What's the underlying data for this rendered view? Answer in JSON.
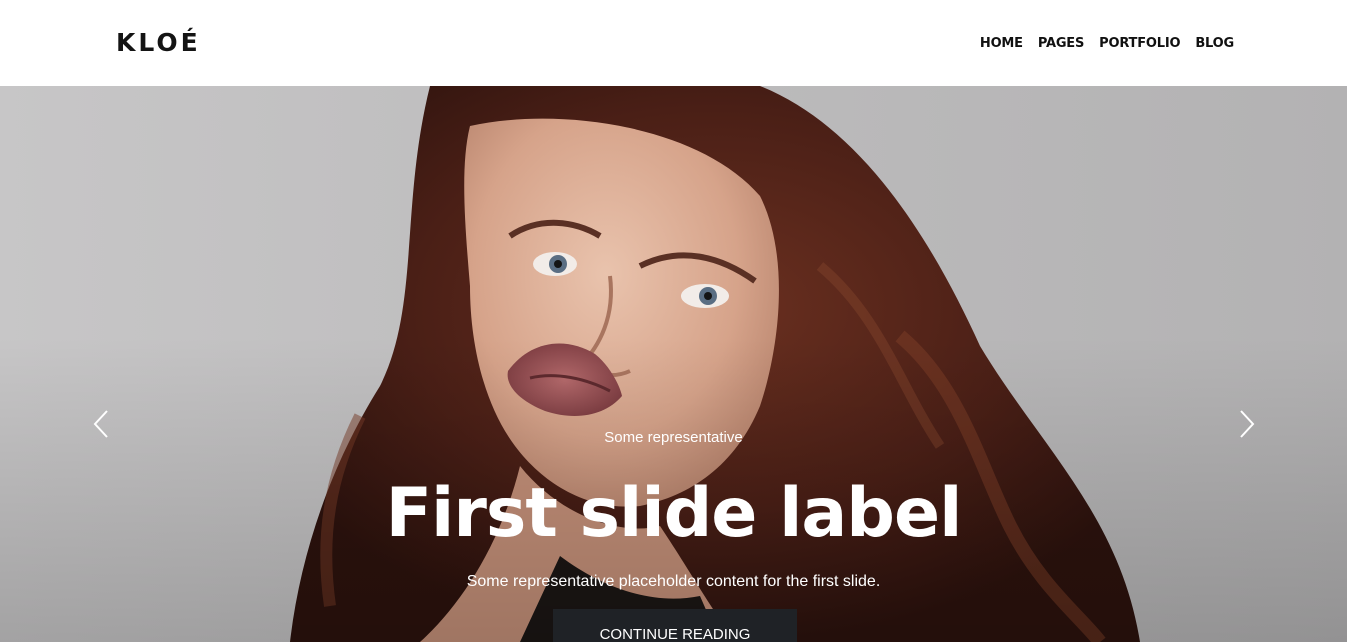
{
  "header": {
    "logo": "KLOÉ",
    "nav": [
      {
        "label": "HOME"
      },
      {
        "label": "PAGES"
      },
      {
        "label": "PORTFOLIO"
      },
      {
        "label": "BLOG"
      }
    ]
  },
  "hero": {
    "eyebrow": "Some representative",
    "title": "First slide label",
    "text": "Some representative placeholder content for the first slide.",
    "cta_label": "CONTINUE READING",
    "prev_icon": "chevron-left-icon",
    "next_icon": "chevron-right-icon",
    "photo": "portrait of woman with long auburn wavy hair on grey background"
  },
  "colors": {
    "header_bg": "#ffffff",
    "logo_text": "#141414",
    "hero_bg": "#c2c1c2",
    "caption_text": "#ffffff",
    "cta_bg": "#1f2226"
  }
}
